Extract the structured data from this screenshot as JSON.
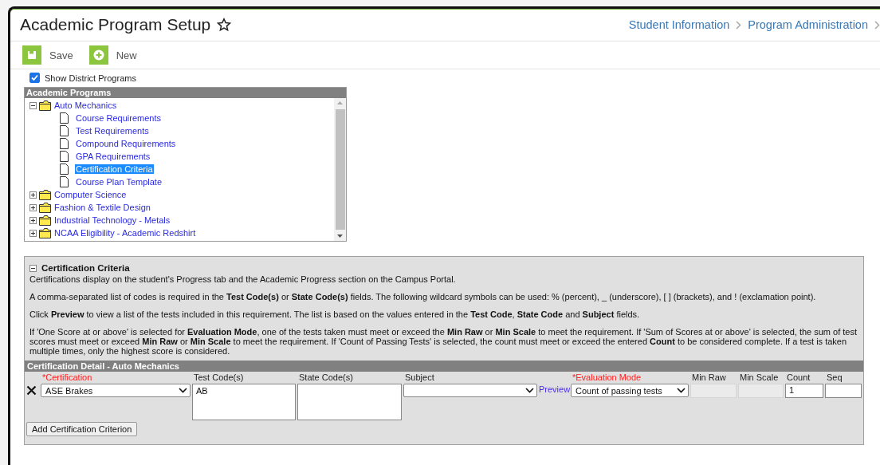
{
  "header": {
    "title": "Academic Program Setup",
    "breadcrumbs": [
      "Student Information",
      "Program Administration"
    ]
  },
  "toolbar": [
    {
      "kind": "save",
      "label": "Save"
    },
    {
      "kind": "new",
      "label": "New"
    }
  ],
  "show_district_programs": {
    "label": "Show District Programs",
    "checked": true
  },
  "tree": {
    "title": "Academic Programs",
    "items": [
      {
        "label": "Auto Mechanics",
        "expanded": true,
        "selected": false,
        "children": [
          {
            "label": "Course Requirements",
            "selected": false
          },
          {
            "label": "Test Requirements",
            "selected": false
          },
          {
            "label": "Compound Requirements",
            "selected": false
          },
          {
            "label": "GPA Requirements",
            "selected": false
          },
          {
            "label": "Certification Criteria",
            "selected": true
          },
          {
            "label": "Course Plan Template",
            "selected": false
          }
        ]
      },
      {
        "label": "Computer Science",
        "expanded": false,
        "selected": false
      },
      {
        "label": "Fashion & Textile Design",
        "expanded": false,
        "selected": false
      },
      {
        "label": "Industrial Technology - Metals",
        "expanded": false,
        "selected": false
      },
      {
        "label": "NCAA Eligibility - Academic Redshirt",
        "expanded": false,
        "selected": false
      }
    ]
  },
  "criteria": {
    "title": "Certification Criteria",
    "expanded": true,
    "paragraphs": [
      "Certifications display on the student's Progress tab and the Academic Progress section on the Campus Portal.",
      "A comma-separated list of codes is required in the **Test Code(s)** or **State Code(s)** fields. The following wildcard symbols can be used: % (percent), _ (underscore), [ ] (brackets), and ! (exclamation point).",
      "Click **Preview** to view a list of the tests included in this requirement. The list is based on the values entered in the **Test Code**, **State Code** and **Subject** fields.",
      "If 'One Score at or above' is selected for **Evaluation Mode**, one of the tests taken must meet or exceed the **Min Raw** or **Min Scale** to meet the requirement. If 'Sum of Scores at or above' is selected, the sum of test scores must meet or exceed **Min Raw** or **Min Scale** to meet the requirement. If 'Count of Passing Tests' is selected, the count must meet or exceed the entered **Count** to be considered complete. If a test is taken multiple times, only the highest score is considered."
    ]
  },
  "detail": {
    "title": "Certification Detail - Auto Mechanics",
    "columns": [
      {
        "label": "*Certification",
        "required": true
      },
      {
        "label": "Test Code(s)",
        "required": false
      },
      {
        "label": "State Code(s)",
        "required": false
      },
      {
        "label": "Subject",
        "required": false
      },
      {
        "label": "*Evaluation Mode",
        "required": true
      },
      {
        "label": "Min Raw",
        "required": false
      },
      {
        "label": "Min Scale",
        "required": false
      },
      {
        "label": "Count",
        "required": false
      },
      {
        "label": "Seq",
        "required": false
      }
    ],
    "row": {
      "certification": "ASE Brakes",
      "test_codes": "AB",
      "preview": "Preview",
      "evaluation_mode": "Count of passing tests",
      "count": "1"
    },
    "add_button": "Add Certification Criterion"
  }
}
